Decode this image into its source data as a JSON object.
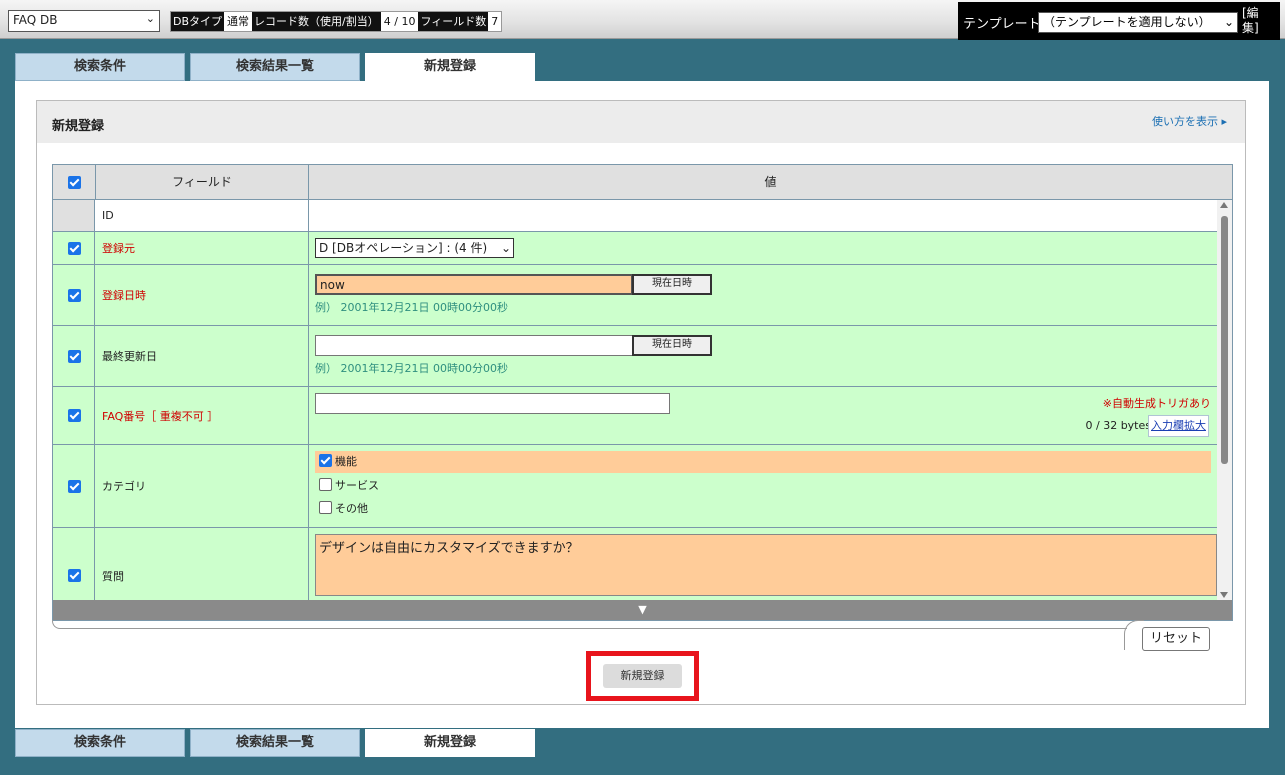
{
  "header": {
    "db_select_value": "FAQ DB",
    "dbinfo": [
      {
        "label": "DBタイプ",
        "value": "通常"
      },
      {
        "label": "レコード数（使用/割当）",
        "value": "4 / 10"
      },
      {
        "label": "フィールド数",
        "value": "7"
      }
    ],
    "template_label": "テンプレート",
    "template_select_value": "（テンプレートを適用しない）",
    "template_edit": "[編集]"
  },
  "tabs": [
    {
      "label": "検索条件",
      "active": false
    },
    {
      "label": "検索結果一覧",
      "active": false
    },
    {
      "label": "新規登録",
      "active": true
    }
  ],
  "card": {
    "title": "新規登録",
    "howto_link": "使い方を表示 ▸"
  },
  "grid": {
    "headers": {
      "field": "フィールド",
      "value": "値"
    },
    "rows": {
      "id": {
        "label": "ID"
      },
      "source": {
        "label": "登録元",
        "select_value": "D [DBオペレーション] : (4 件)"
      },
      "registered": {
        "label": "登録日時",
        "value": "now",
        "button": "現在日時",
        "hint": "例） 2001年12月21日 00時00分00秒"
      },
      "updated": {
        "label": "最終更新日",
        "value": "",
        "button": "現在日時",
        "hint": "例） 2001年12月21日 00時00分00秒"
      },
      "faqno": {
        "label": "FAQ番号［ 重複不可 ］",
        "value": "",
        "trigger_note": "※自動生成トリガあり",
        "bytes": "0 / 32 bytes",
        "expand_link": "入力欄拡大"
      },
      "category": {
        "label": "カテゴリ",
        "options": [
          {
            "label": "機能",
            "checked": true
          },
          {
            "label": "サービス",
            "checked": false
          },
          {
            "label": "その他",
            "checked": false
          }
        ]
      },
      "question": {
        "label": "質問",
        "value": "デザインは自由にカスタマイズできますか？"
      }
    },
    "expand_arrow": "▼"
  },
  "buttons": {
    "reset": "リセット",
    "submit": "新規登録"
  }
}
